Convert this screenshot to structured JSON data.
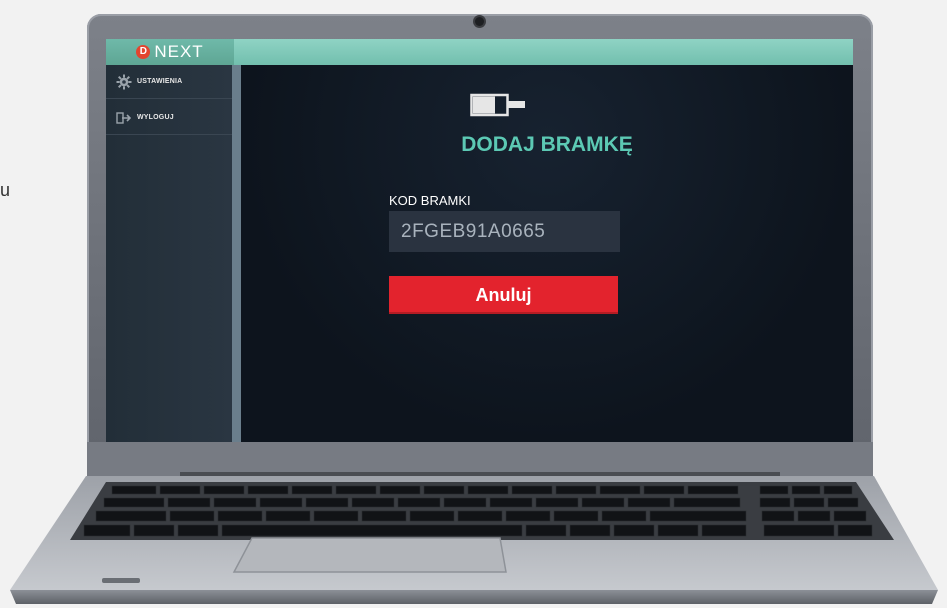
{
  "page": {
    "side_text": "u"
  },
  "app": {
    "logo_text": "NEXT",
    "logo_mark": "D"
  },
  "sidebar": {
    "items": [
      {
        "label": "USTAWIENIA",
        "icon": "gear-icon"
      },
      {
        "label": "WYLOGUJ",
        "icon": "logout-icon"
      }
    ]
  },
  "main": {
    "title": "DODAJ BRAMKĘ",
    "code_label": "KOD BRAMKI",
    "code_value": "2FGEB91A0665",
    "cancel_label": "Anuluj"
  },
  "colors": {
    "accent": "#5cc9b4",
    "topbar": "#7ec9b8",
    "cancel": "#e3232d",
    "screen_bg": "#0f1722"
  }
}
